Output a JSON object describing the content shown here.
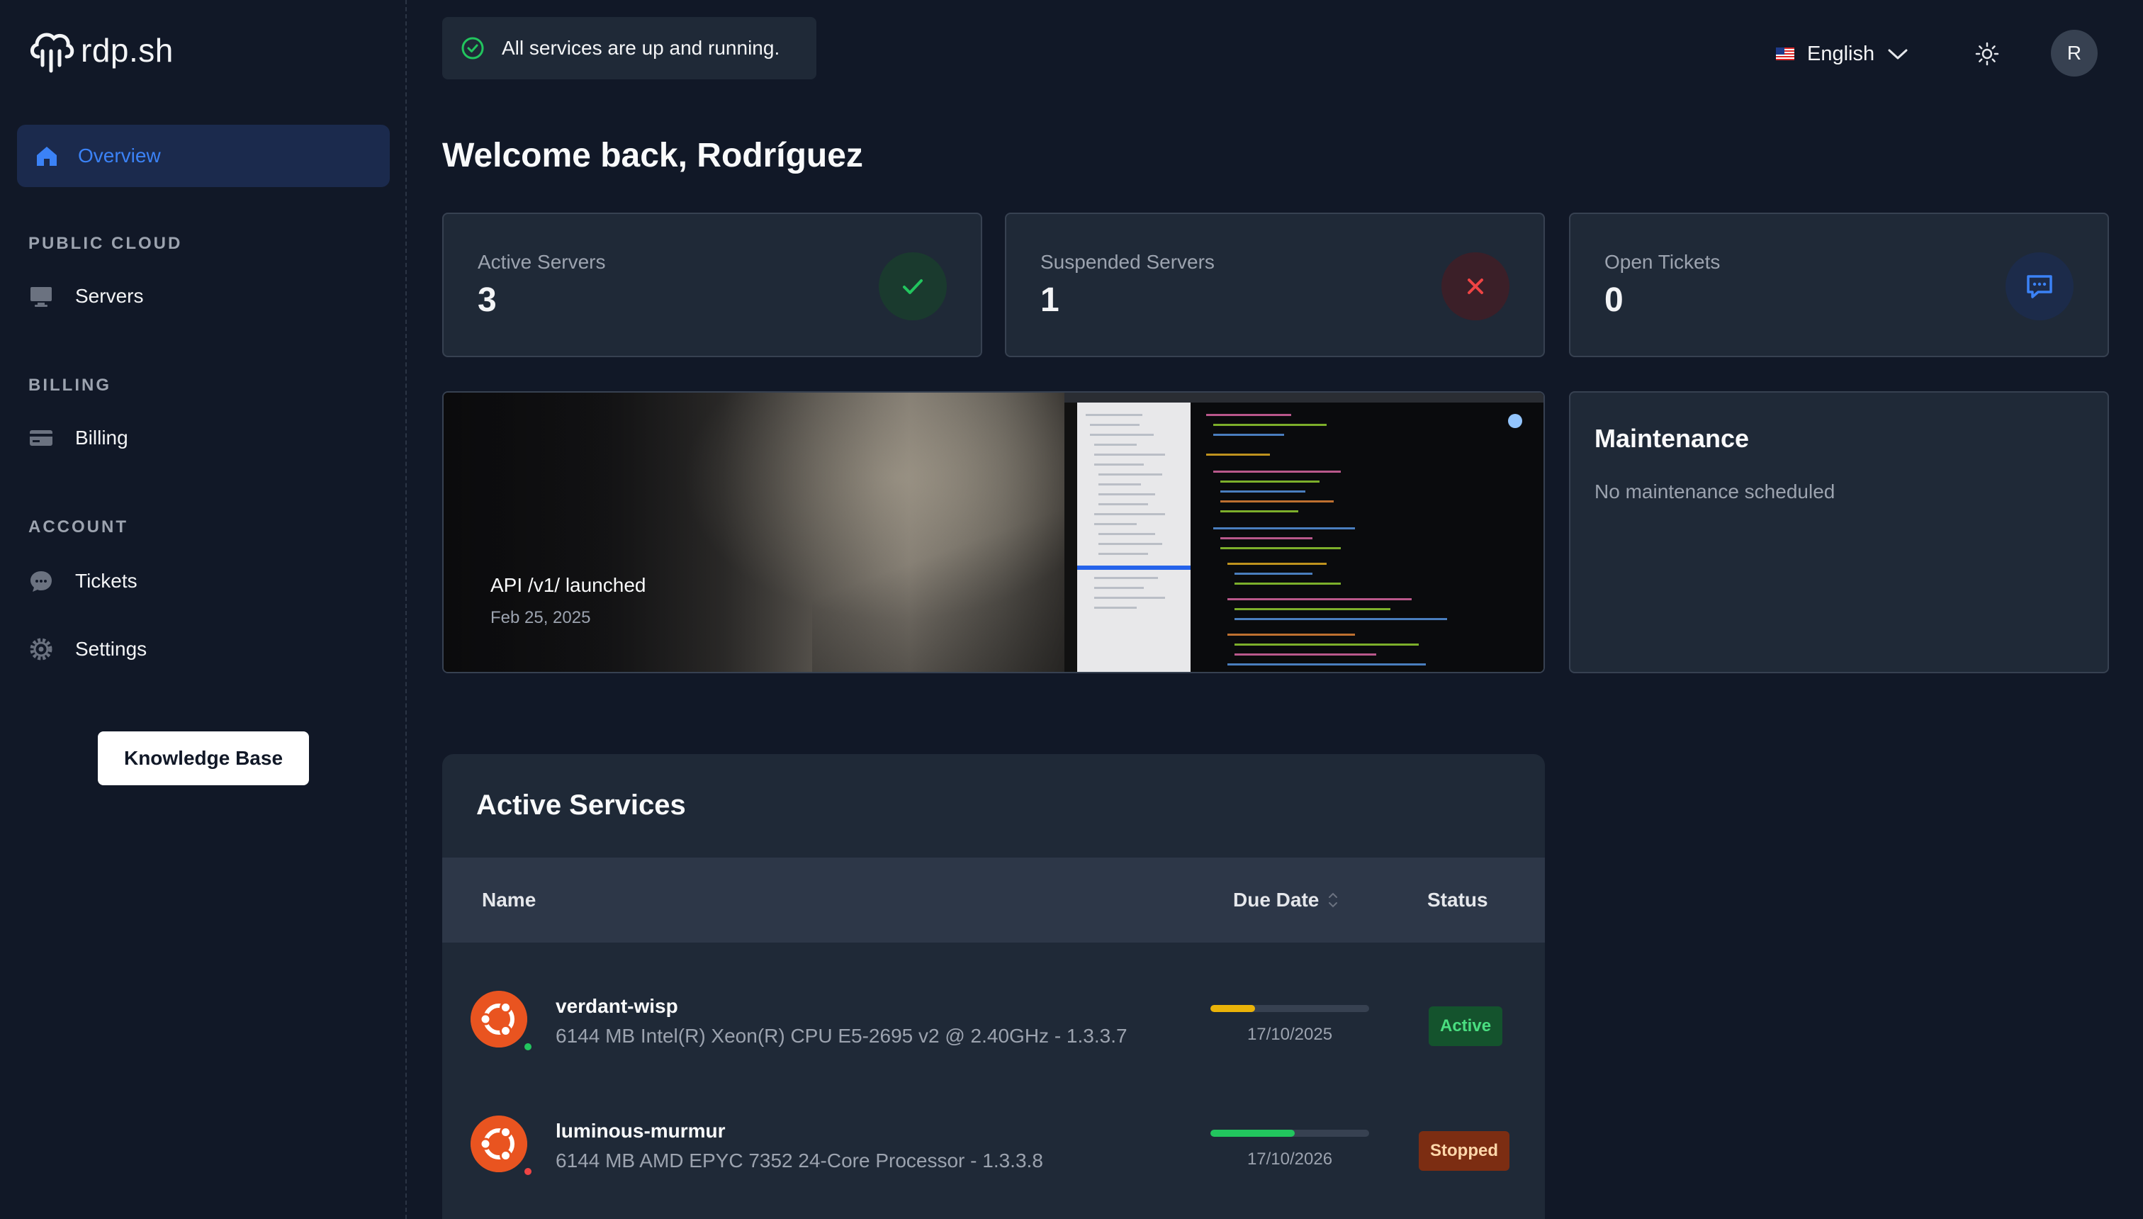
{
  "brand": {
    "name": "rdp.sh"
  },
  "sidebar": {
    "overview_label": "Overview",
    "sections": [
      {
        "title": "PUBLIC CLOUD",
        "items": [
          {
            "label": "Servers",
            "icon": "monitor-icon"
          }
        ]
      },
      {
        "title": "BILLING",
        "items": [
          {
            "label": "Billing",
            "icon": "credit-card-icon"
          }
        ]
      },
      {
        "title": "ACCOUNT",
        "items": [
          {
            "label": "Tickets",
            "icon": "chat-bubble-icon"
          },
          {
            "label": "Settings",
            "icon": "gear-icon"
          }
        ]
      }
    ],
    "knowledge_base_label": "Knowledge Base"
  },
  "topbar": {
    "status_message": "All services are up and running.",
    "language": "English",
    "avatar_initial": "R"
  },
  "page": {
    "title": "Welcome back, Rodríguez"
  },
  "stats": [
    {
      "label": "Active Servers",
      "value": "3",
      "icon": "check-icon",
      "color": "#22c55e"
    },
    {
      "label": "Suspended Servers",
      "value": "1",
      "icon": "x-icon",
      "color": "#ef4444"
    },
    {
      "label": "Open Tickets",
      "value": "0",
      "icon": "message-icon",
      "color": "#3b82f6"
    }
  ],
  "news": {
    "title": "API /v1/ launched",
    "date": "Feb 25, 2025"
  },
  "maintenance": {
    "title": "Maintenance",
    "text": "No maintenance scheduled"
  },
  "services": {
    "title": "Active Services",
    "columns": {
      "name": "Name",
      "due_date": "Due Date",
      "status": "Status"
    },
    "rows": [
      {
        "name": "verdant-wisp",
        "description": "6144 MB Intel(R) Xeon(R) CPU E5-2695 v2 @ 2.40GHz - 1.3.3.7",
        "due_date": "17/10/2025",
        "due_progress": 0.28,
        "due_color": "#eab308",
        "status": "Active",
        "status_dot_color": "#22c55e"
      },
      {
        "name": "luminous-murmur",
        "description": "6144 MB AMD EPYC 7352 24-Core Processor - 1.3.3.8",
        "due_date": "17/10/2026",
        "due_progress": 0.53,
        "due_color": "#22c55e",
        "status": "Stopped",
        "status_dot_color": "#ef4444"
      }
    ]
  }
}
